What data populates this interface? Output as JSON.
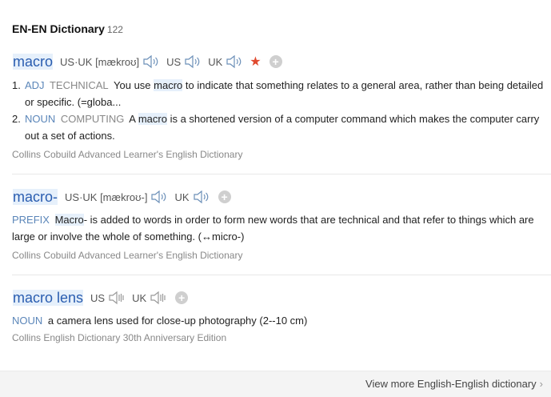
{
  "header": {
    "title": "EN-EN Dictionary",
    "count": "122"
  },
  "entries": [
    {
      "headword": "macro",
      "pron_main": "US·UK [mækroʊ]",
      "us_label": "US",
      "uk_label": "UK",
      "senses": [
        {
          "num": "1.",
          "pos": "ADJ",
          "field": "TECHNICAL",
          "pre": "You use ",
          "hl": "macro",
          "post": " to indicate that something relates to a general area, rather than being detailed or specific. (=globa..."
        },
        {
          "num": "2.",
          "pos": "NOUN",
          "field": "COMPUTING",
          "pre": "A ",
          "hl": "macro",
          "post": " is a shortened version of a computer command which makes the computer carry out a set of actions."
        }
      ],
      "source": "Collins Cobuild Advanced Learner's English Dictionary"
    },
    {
      "headword": "macro-",
      "pron_main": "US·UK [mækroʊ-]",
      "uk_label": "UK",
      "sense": {
        "pos": "PREFIX",
        "hl": "Macro",
        "post": "- is added to words in order to form new words that are technical and that refer to things which are large or involve the whole of something. (↔micro-)"
      },
      "source": "Collins Cobuild Advanced Learner's English Dictionary"
    },
    {
      "headword": "macro lens",
      "us_label": "US",
      "uk_label": "UK",
      "sense": {
        "pos": "NOUN",
        "text": "a camera lens used for close-up photography (2--10 cm)"
      },
      "source": "Collins English Dictionary 30th Anniversary Edition"
    }
  ],
  "footer": {
    "more_label": "View more English-English dictionary",
    "arrow": "›"
  },
  "icons": {
    "speaker": "speaker-icon",
    "star": "star-icon",
    "add": "plus-icon"
  },
  "colors": {
    "headword": "#2a5db0",
    "pos": "#5b86b9",
    "star": "#e04a2f",
    "highlight": "#e6f0fb"
  }
}
